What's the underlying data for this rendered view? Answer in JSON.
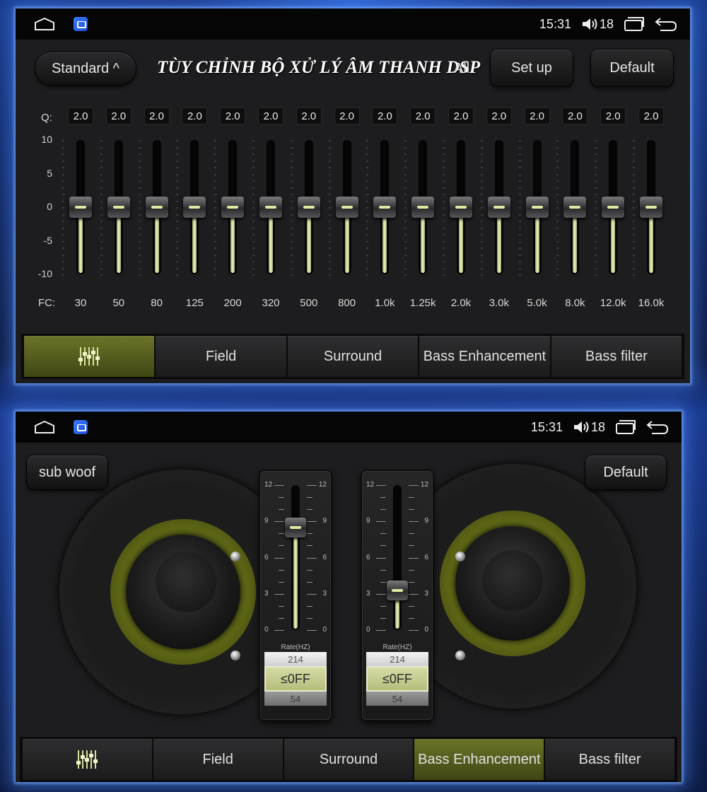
{
  "status": {
    "time": "15:31",
    "volume": "18"
  },
  "eq_panel": {
    "preset": "Standard ^",
    "title": "TÙY CHỈNH BỘ XỬ LÝ ÂM THANH DSP",
    "all_label": "All",
    "setup_label": "Set up",
    "default_label": "Default",
    "q_label": "Q:",
    "fc_label": "FC:",
    "db_scale": [
      "10",
      "5",
      "0",
      "-5",
      "-10"
    ],
    "bands": [
      {
        "q": "2.0",
        "fc": "30",
        "gain": 0
      },
      {
        "q": "2.0",
        "fc": "50",
        "gain": 0
      },
      {
        "q": "2.0",
        "fc": "80",
        "gain": 0
      },
      {
        "q": "2.0",
        "fc": "125",
        "gain": 0
      },
      {
        "q": "2.0",
        "fc": "200",
        "gain": 0
      },
      {
        "q": "2.0",
        "fc": "320",
        "gain": 0
      },
      {
        "q": "2.0",
        "fc": "500",
        "gain": 0
      },
      {
        "q": "2.0",
        "fc": "800",
        "gain": 0
      },
      {
        "q": "2.0",
        "fc": "1.0k",
        "gain": 0
      },
      {
        "q": "2.0",
        "fc": "1.25k",
        "gain": 0
      },
      {
        "q": "2.0",
        "fc": "2.0k",
        "gain": 0
      },
      {
        "q": "2.0",
        "fc": "3.0k",
        "gain": 0
      },
      {
        "q": "2.0",
        "fc": "5.0k",
        "gain": 0
      },
      {
        "q": "2.0",
        "fc": "8.0k",
        "gain": 0
      },
      {
        "q": "2.0",
        "fc": "12.0k",
        "gain": 0
      },
      {
        "q": "2.0",
        "fc": "16.0k",
        "gain": 0
      }
    ],
    "tabs": [
      {
        "label": "",
        "icon": "equalizer-icon",
        "active": true
      },
      {
        "label": "Field",
        "active": false
      },
      {
        "label": "Surround",
        "active": false
      },
      {
        "label": "Bass Enhancement",
        "active": false
      },
      {
        "label": "Bass filter",
        "active": false
      }
    ]
  },
  "bass_panel": {
    "subwoof_label": "sub woof",
    "default_label": "Default",
    "scale": [
      "12",
      "9",
      "6",
      "3",
      "0"
    ],
    "sliders": [
      {
        "level": 8.5,
        "rate_label": "Rate(HZ)",
        "rate_above": "214",
        "rate_value": "≤0FF",
        "rate_below": "54"
      },
      {
        "level": 3.3,
        "rate_label": "Rate(HZ)",
        "rate_above": "214",
        "rate_value": "≤0FF",
        "rate_below": "54"
      }
    ],
    "tabs": [
      {
        "label": "",
        "icon": "equalizer-icon",
        "active": false
      },
      {
        "label": "Field",
        "active": false
      },
      {
        "label": "Surround",
        "active": false
      },
      {
        "label": "Bass Enhancement",
        "active": true
      },
      {
        "label": "Bass filter",
        "active": false
      }
    ]
  },
  "colors": {
    "accent": "#dfe9a4",
    "active_tab": "#6c7428",
    "glow": "#3b7cff"
  }
}
